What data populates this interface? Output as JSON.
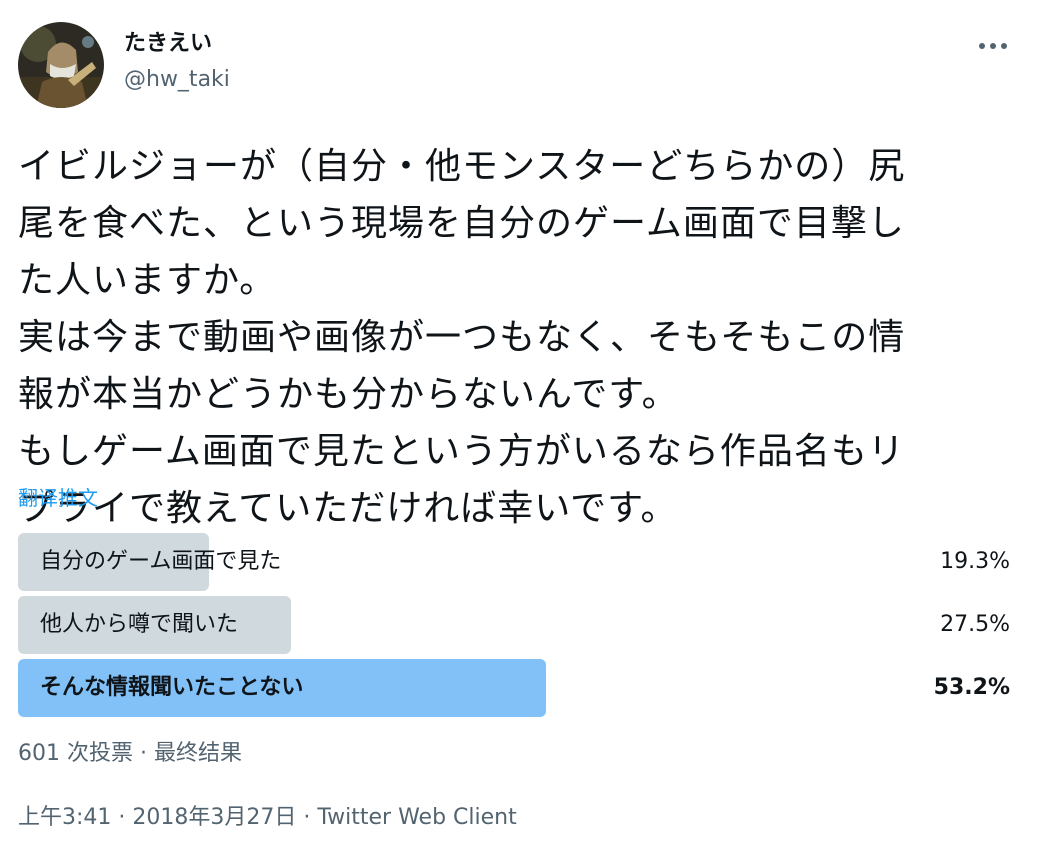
{
  "user": {
    "display_name": "たきえい",
    "handle": "@hw_taki",
    "avatar_icon": "user-avatar"
  },
  "more_icon": "more-dots-icon",
  "tweet": {
    "lines": [
      "イビルジョーが（自分・他モンスターどちらかの）尻",
      "尾を食べた、という現場を自分のゲーム画面で目撃し",
      "た人いますか。",
      "実は今まで動画や画像が一つもなく、そもそもこの情",
      "報が本当かどうかも分からないんです。",
      "もしゲーム画面で見たという方がいるなら作品名もリ",
      "プライで教えていただければ幸いです。"
    ],
    "translate_label": "翻译推文"
  },
  "poll": {
    "options": [
      {
        "label": "自分のゲーム画面で見た",
        "percent_text": "19.3%",
        "percent": 19.3
      },
      {
        "label": "他人から噂で聞いた",
        "percent_text": "27.5%",
        "percent": 27.5
      },
      {
        "label": "そんな情報聞いたことない",
        "percent_text": "53.2%",
        "percent": 53.2
      }
    ],
    "summary": "601 次投票 · 最终结果"
  },
  "meta": {
    "text": "上午3:41 · 2018年3月27日 · Twitter Web Client"
  },
  "colors": {
    "bar": "#cfd9de",
    "bar_winner": "#81c1f7",
    "link": "#1d9bf0",
    "secondary": "#536471"
  }
}
